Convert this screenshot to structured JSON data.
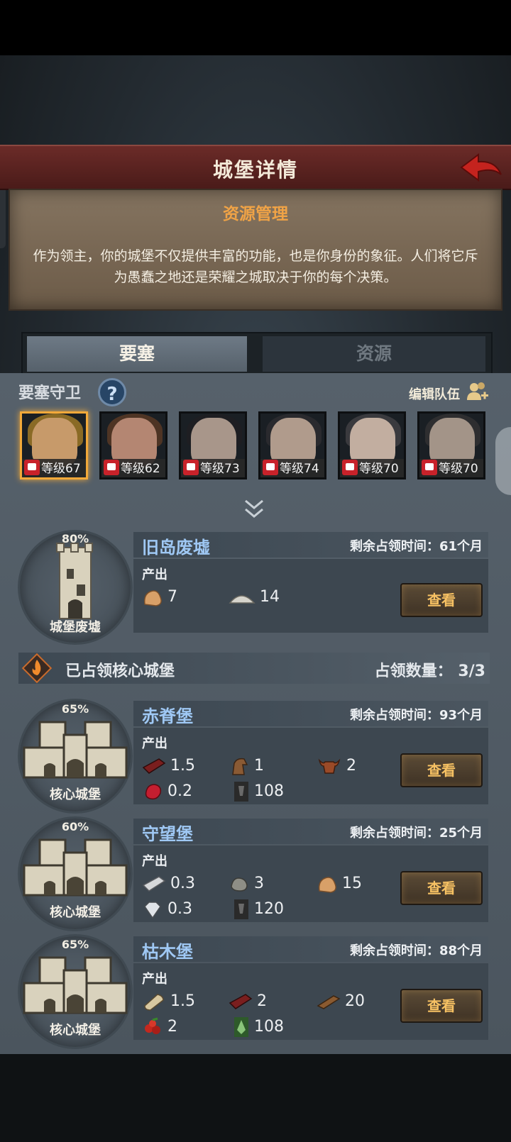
{
  "header": {
    "title": "城堡详情"
  },
  "intro": {
    "title": "资源管理",
    "text": "作为领主，你的城堡不仅提供丰富的功能，也是你身份的象征。人们将它斥为愚蠢之地还是荣耀之城取决于你的每个决策。"
  },
  "tabs": [
    {
      "label": "要塞"
    },
    {
      "label": "资源"
    }
  ],
  "guards": {
    "label": "要塞守卫",
    "edit_label": "编辑队伍",
    "heroes": [
      {
        "level": "等级67",
        "selected": true
      },
      {
        "level": "等级62"
      },
      {
        "level": "等级73"
      },
      {
        "level": "等级74"
      },
      {
        "level": "等级70"
      },
      {
        "level": "等级70"
      }
    ]
  },
  "ruin": {
    "name": "旧岛废墟",
    "time_label": "剩余占领时间：",
    "time_value": "61个月",
    "percent": "80%",
    "type": "城堡废墟",
    "produce_label": "产出",
    "resources": [
      {
        "icon": "ore-icon",
        "value": "7"
      },
      {
        "icon": "silver-pile-icon",
        "value": "14"
      }
    ],
    "button": "查看"
  },
  "core": {
    "title": "已占领核心城堡",
    "count_label": "占领数量：",
    "count_value": "3/3",
    "castles": [
      {
        "name": "赤脊堡",
        "time_label": "剩余占领时间：",
        "time_value": "93个月",
        "percent": "65%",
        "type": "核心城堡",
        "produce_label": "产出",
        "resources": [
          {
            "icon": "iron-ingot-icon",
            "value": "1.5"
          },
          {
            "icon": "horse-icon",
            "value": "1"
          },
          {
            "icon": "ox-icon",
            "value": "2"
          },
          {
            "icon": "ruby-icon",
            "value": "0.2"
          },
          {
            "icon": "banner-icon",
            "value": "108"
          }
        ],
        "button": "查看"
      },
      {
        "name": "守望堡",
        "time_label": "剩余占领时间：",
        "time_value": "25个月",
        "percent": "60%",
        "type": "核心城堡",
        "produce_label": "产出",
        "resources": [
          {
            "icon": "silver-ingot-icon",
            "value": "0.3"
          },
          {
            "icon": "stone-icon",
            "value": "3"
          },
          {
            "icon": "ore-icon",
            "value": "15"
          },
          {
            "icon": "diamond-icon",
            "value": "0.3"
          },
          {
            "icon": "banner-icon",
            "value": "120"
          }
        ],
        "button": "查看"
      },
      {
        "name": "枯木堡",
        "time_label": "剩余占领时间：",
        "time_value": "88个月",
        "percent": "65%",
        "type": "核心城堡",
        "produce_label": "产出",
        "resources": [
          {
            "icon": "log-icon",
            "value": "1.5"
          },
          {
            "icon": "iron-ingot-icon",
            "value": "2"
          },
          {
            "icon": "plank-icon",
            "value": "20"
          },
          {
            "icon": "berries-icon",
            "value": "2"
          },
          {
            "icon": "green-banner-icon",
            "value": "108"
          }
        ],
        "button": "查看"
      }
    ]
  },
  "colors": {
    "accent_gold": "#f2a93a",
    "castle_name_blue": "#9fc8f4",
    "header_red": "#6b2b28"
  }
}
